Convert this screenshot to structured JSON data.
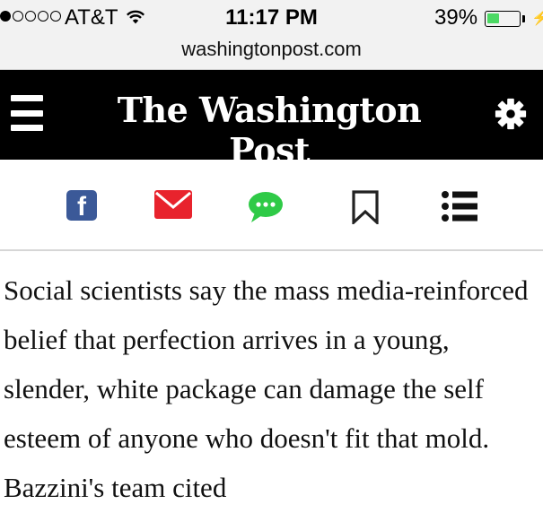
{
  "status_bar": {
    "carrier": "AT&T",
    "time": "11:17 PM",
    "battery_percent": "39%",
    "battery_level": 0.39,
    "signal_dots_filled": 1,
    "signal_dots_total": 5,
    "battery_fill_color": "#4cd964"
  },
  "browser": {
    "url": "washingtonpost.com"
  },
  "header": {
    "logo_text": "The Washington Post",
    "menu_icon": "hamburger-menu-icon",
    "settings_icon": "gear-icon",
    "background": "#000000"
  },
  "share_toolbar": {
    "items": [
      {
        "icon": "facebook-icon",
        "color": "#3b5998",
        "glyph": "f"
      },
      {
        "icon": "email-icon",
        "color": "#e8232d"
      },
      {
        "icon": "message-icon",
        "color": "#2fca47"
      },
      {
        "icon": "bookmark-icon",
        "color": "#222222"
      },
      {
        "icon": "list-icon",
        "color": "#111111"
      }
    ]
  },
  "article": {
    "paragraph": "Social scientists say the mass media-reinforced belief that perfection arrives in a young, slender, white package can damage the self esteem of anyone who doesn't fit that mold. Bazzini's team cited"
  }
}
